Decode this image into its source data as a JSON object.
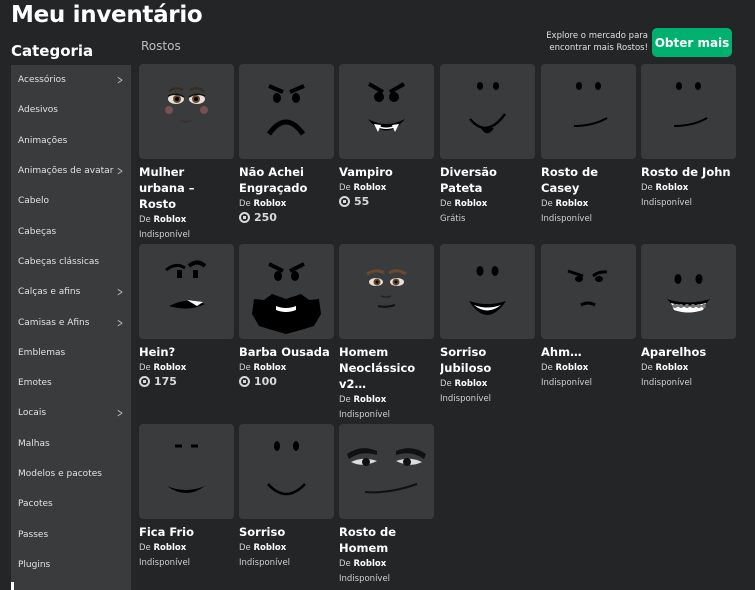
{
  "page": {
    "title": "Meu inventário",
    "category_title": "Categoria",
    "section": "Rostos"
  },
  "promo": {
    "text_line1": "Explore o mercado para",
    "text_line2": "encontrar mais Rostos!",
    "button": "Obter mais"
  },
  "sidebar": [
    {
      "label": "Acessórios",
      "chevron": true
    },
    {
      "label": "Adesivos",
      "chevron": false
    },
    {
      "label": "Animações",
      "chevron": false
    },
    {
      "label": "Animações de avatar",
      "chevron": true
    },
    {
      "label": "Cabelo",
      "chevron": false
    },
    {
      "label": "Cabeças",
      "chevron": false
    },
    {
      "label": "Cabeças clássicas",
      "chevron": false
    },
    {
      "label": "Calças e afins",
      "chevron": true
    },
    {
      "label": "Camisas e Afins",
      "chevron": true
    },
    {
      "label": "Emblemas",
      "chevron": false
    },
    {
      "label": "Emotes",
      "chevron": false
    },
    {
      "label": "Locais",
      "chevron": true
    },
    {
      "label": "Malhas",
      "chevron": false
    },
    {
      "label": "Modelos e pacotes",
      "chevron": false
    },
    {
      "label": "Pacotes",
      "chevron": false
    },
    {
      "label": "Passes",
      "chevron": false
    },
    {
      "label": "Plugins",
      "chevron": false
    }
  ],
  "creator_prefix": "De",
  "items": [
    {
      "name": "Mulher urbana – Rosto",
      "creator": "Roblox",
      "status": "Indisponível",
      "face": "woman-face"
    },
    {
      "name": "Não Achei Engraçado",
      "creator": "Roblox",
      "price": "250",
      "face": "angry-frown-face"
    },
    {
      "name": "Vampiro",
      "creator": "Roblox",
      "price": "55",
      "face": "vampire-face"
    },
    {
      "name": "Diversão Pateta",
      "creator": "Roblox",
      "status": "Grátis",
      "face": "goofy-face"
    },
    {
      "name": "Rosto de Casey",
      "creator": "Roblox",
      "status": "Indisponível",
      "face": "smirk-face"
    },
    {
      "name": "Rosto de John",
      "creator": "Roblox",
      "status": "Indisponível",
      "face": "smirk-face"
    },
    {
      "name": "Hein?",
      "creator": "Roblox",
      "price": "175",
      "face": "confused-face"
    },
    {
      "name": "Barba Ousada",
      "creator": "Roblox",
      "price": "100",
      "face": "beard-face"
    },
    {
      "name": "Homem Neoclássico v2…",
      "creator": "Roblox",
      "status": "Indisponível",
      "face": "man-face"
    },
    {
      "name": "Sorriso Jubiloso",
      "creator": "Roblox",
      "status": "Indisponível",
      "face": "grin-face"
    },
    {
      "name": "Ahm…",
      "creator": "Roblox",
      "status": "Indisponível",
      "face": "hmm-face"
    },
    {
      "name": "Aparelhos",
      "creator": "Roblox",
      "status": "Indisponível",
      "face": "braces-face"
    },
    {
      "name": "Fica Frio",
      "creator": "Roblox",
      "status": "Indisponível",
      "face": "chill-face"
    },
    {
      "name": "Sorriso",
      "creator": "Roblox",
      "status": "Indisponível",
      "face": "smile-face"
    },
    {
      "name": "Rosto de Homem",
      "creator": "Roblox",
      "status": "Indisponível",
      "face": "man-classic-face"
    }
  ]
}
